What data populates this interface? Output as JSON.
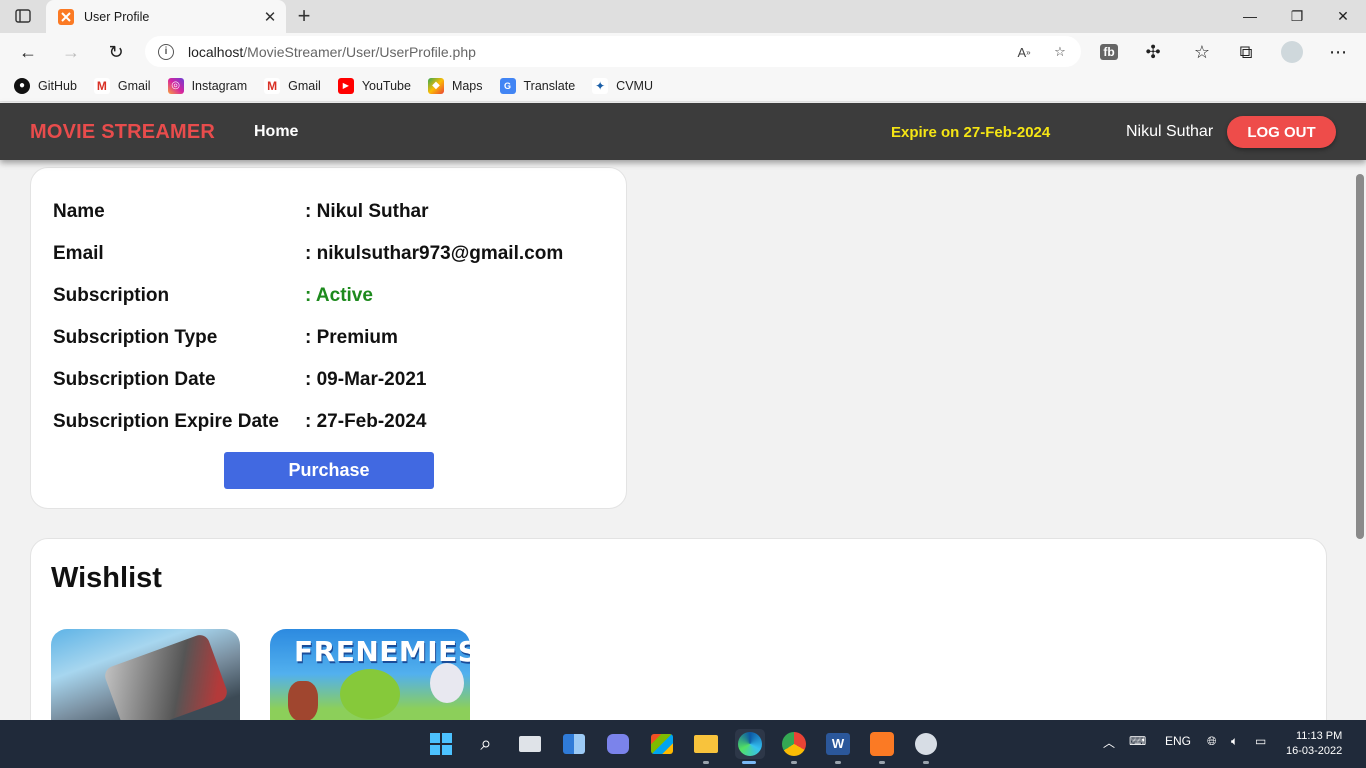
{
  "browser": {
    "tab_title": "User Profile",
    "url_host": "localhost",
    "url_path": "/MovieStreamer/User/UserProfile.php",
    "bookmarks": [
      {
        "label": "GitHub",
        "icon": "github-icon",
        "color": "#111111"
      },
      {
        "label": "Gmail",
        "icon": "gmail-icon",
        "color": "#d93025"
      },
      {
        "label": "Instagram",
        "icon": "instagram-icon",
        "color": "#d6249f"
      },
      {
        "label": "Gmail",
        "icon": "gmail-icon",
        "color": "#d93025"
      },
      {
        "label": "YouTube",
        "icon": "youtube-icon",
        "color": "#ff0000"
      },
      {
        "label": "Maps",
        "icon": "maps-icon",
        "color": "#34a853"
      },
      {
        "label": "Translate",
        "icon": "translate-icon",
        "color": "#4285f4"
      },
      {
        "label": "CVMU",
        "icon": "cvmu-icon",
        "color": "#1a5fa8"
      }
    ]
  },
  "nav": {
    "brand": "MOVIE STREAMER",
    "home": "Home",
    "expire": "Expire on 27-Feb-2024",
    "username": "Nikul Suthar",
    "logout": "LOG OUT"
  },
  "profile": {
    "rows": [
      {
        "label": "Name",
        "value": ": Nikul Suthar"
      },
      {
        "label": "Email",
        "value": ": nikulsuthar973@gmail.com"
      },
      {
        "label": "Subscription",
        "value": ": Active"
      },
      {
        "label": "Subscription Type",
        "value": ": Premium"
      },
      {
        "label": "Subscription Date",
        "value": ": 09-Mar-2021"
      },
      {
        "label": "Subscription Expire Date",
        "value": ": 27-Feb-2024"
      }
    ],
    "purchase": "Purchase"
  },
  "wishlist": {
    "title": "Wishlist",
    "posters": [
      {
        "text": ""
      },
      {
        "text": "FRENEMIES"
      }
    ]
  },
  "taskbar": {
    "language": "ENG",
    "time": "11:13 PM",
    "date": "16-03-2022"
  },
  "colors": {
    "brand": "#e84c4c",
    "expire": "#f5e514",
    "active": "#1d8a1d",
    "purchase": "#4169e1",
    "logout": "#ee4c4a"
  }
}
